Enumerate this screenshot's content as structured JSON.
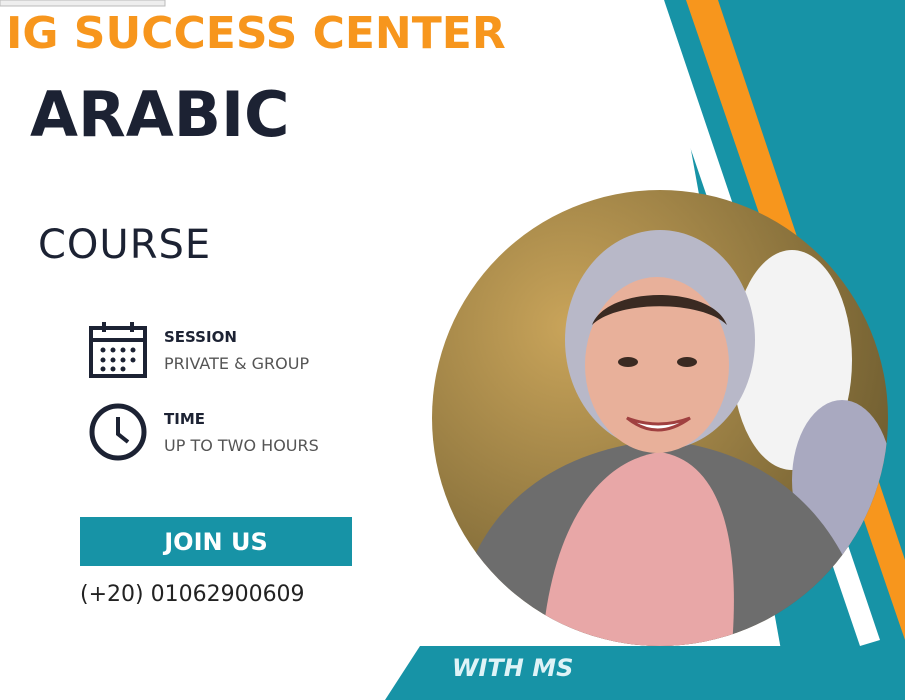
{
  "header": {
    "brand": "IG SUCCESS CENTER",
    "subject": "ARABIC",
    "course": "COURSE"
  },
  "details": [
    {
      "icon": "calendar-icon",
      "label": "SESSION",
      "value": "PRIVATE & GROUP"
    },
    {
      "icon": "clock-icon",
      "label": "TIME",
      "value": "UP TO TWO HOURS"
    }
  ],
  "cta": {
    "label": "JOIN US"
  },
  "contact": {
    "phone": "(+20) 01062900609"
  },
  "footer": {
    "text": "WITH MS"
  },
  "colors": {
    "orange": "#f7961d",
    "teal": "#1793a6",
    "navy": "#1c2233"
  }
}
